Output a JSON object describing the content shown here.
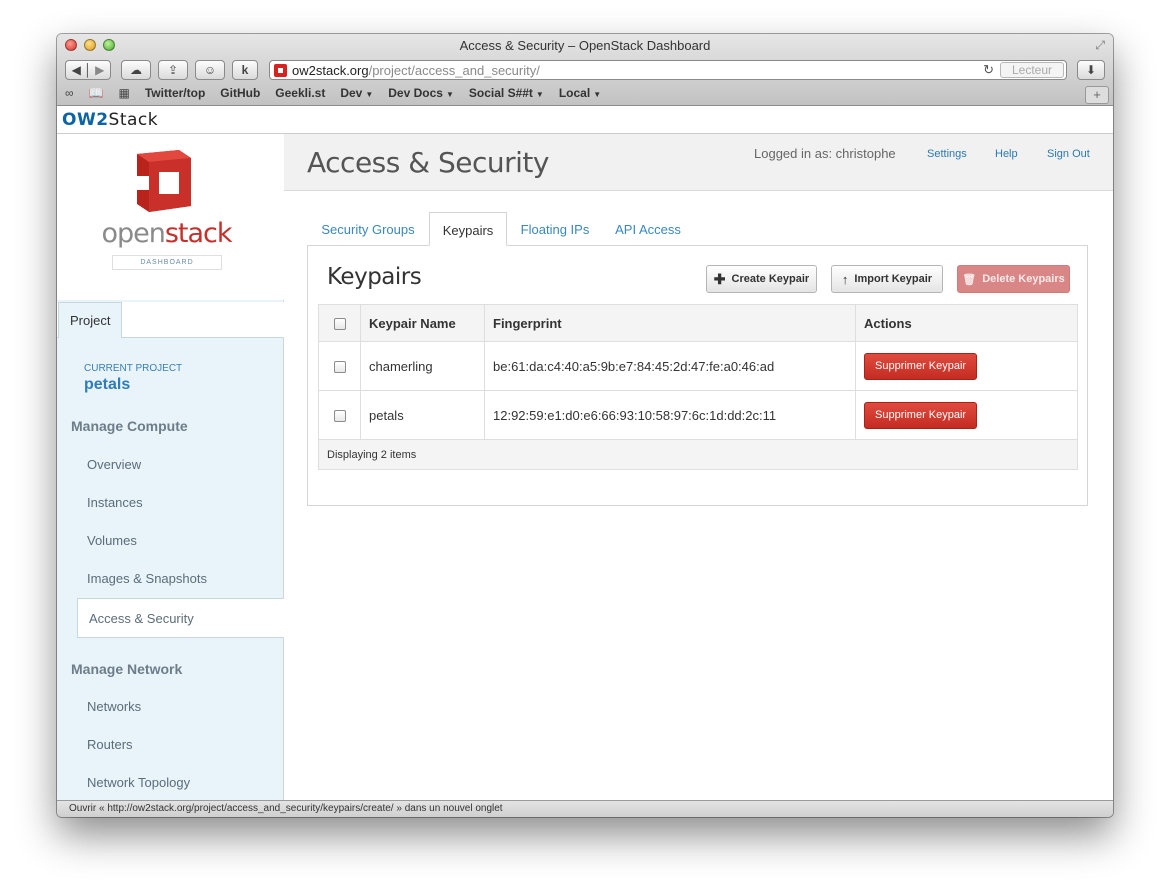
{
  "browser": {
    "window_title": "Access & Security – OpenStack Dashboard",
    "url_host": "ow2stack.org",
    "url_path": "/project/access_and_security/",
    "reader_label": "Lecteur",
    "bookmarks": [
      {
        "label": "Twitter/top",
        "has_menu": false
      },
      {
        "label": "GitHub",
        "has_menu": false
      },
      {
        "label": "Geekli.st",
        "has_menu": false
      },
      {
        "label": "Dev",
        "has_menu": true
      },
      {
        "label": "Dev Docs",
        "has_menu": true
      },
      {
        "label": "Social S##t",
        "has_menu": true
      },
      {
        "label": "Local",
        "has_menu": true
      }
    ],
    "status_text": "Ouvrir « http://ow2stack.org/project/access_and_security/keypairs/create/ » dans un nouvel onglet"
  },
  "brand": {
    "ow2_part1": "OW2",
    "ow2_part2": "Stack",
    "openstack_open": "open",
    "openstack_stack": "stack",
    "dashboard_tag": "DASHBOARD",
    "accent_red": "#c7302a",
    "link_blue": "#2a7ab3"
  },
  "sidebar": {
    "project_tab": "Project",
    "current_project_label": "CURRENT PROJECT",
    "current_project": "petals",
    "sections": [
      {
        "title": "Manage Compute",
        "items": [
          "Overview",
          "Instances",
          "Volumes",
          "Images & Snapshots",
          "Access & Security"
        ]
      },
      {
        "title": "Manage Network",
        "items": [
          "Networks",
          "Routers",
          "Network Topology"
        ]
      }
    ],
    "active_item": "Access & Security"
  },
  "header": {
    "title": "Access & Security",
    "logged_in": "Logged in as: christophe",
    "settings": "Settings",
    "help": "Help",
    "sign_out": "Sign Out"
  },
  "tabs": [
    "Security Groups",
    "Keypairs",
    "Floating IPs",
    "API Access"
  ],
  "active_tab": "Keypairs",
  "panel": {
    "title": "Keypairs",
    "create_label": "Create Keypair",
    "import_label": "Import Keypair",
    "delete_label": "Delete Keypairs",
    "columns": [
      "Keypair Name",
      "Fingerprint",
      "Actions"
    ],
    "rows": [
      {
        "name": "chamerling",
        "fingerprint": "be:61:da:c4:40:a5:9b:e7:84:45:2d:47:fe:a0:46:ad",
        "action": "Supprimer Keypair"
      },
      {
        "name": "petals",
        "fingerprint": "12:92:59:e1:d0:e6:66:93:10:58:97:6c:1d:dd:2c:11",
        "action": "Supprimer Keypair"
      }
    ],
    "footer": "Displaying 2 items"
  }
}
